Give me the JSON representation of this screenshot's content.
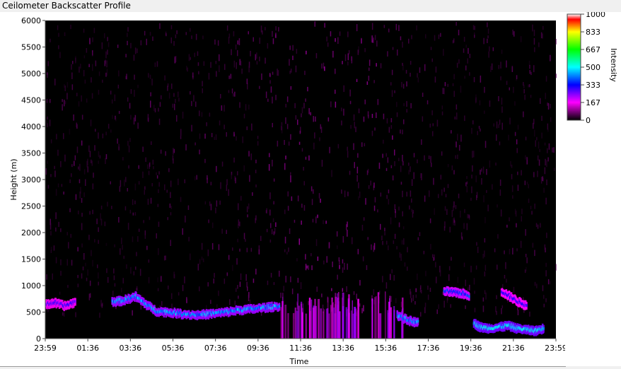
{
  "window": {
    "title": "Ceilometer Backscatter Profile"
  },
  "chart_data": {
    "type": "heatmap",
    "title": "Ceilometer Backscatter Profile",
    "xlabel": "Time",
    "ylabel": "Height (m)",
    "x_ticks": [
      "23:59",
      "01:36",
      "03:36",
      "05:36",
      "07:36",
      "09:36",
      "11:36",
      "13:36",
      "15:36",
      "17:36",
      "19:36",
      "21:36",
      "23:59"
    ],
    "y_ticks": [
      0,
      500,
      1000,
      1500,
      2000,
      2500,
      3000,
      3500,
      4000,
      4500,
      5000,
      5500,
      6000
    ],
    "ylim": [
      0,
      6000
    ],
    "colorbar": {
      "label": "Intensity",
      "ticks": [
        0,
        167,
        333,
        500,
        667,
        833,
        1000
      ],
      "range": [
        0,
        1000
      ],
      "colors": [
        "#000000",
        "#ff00ff",
        "#0000ff",
        "#00ffff",
        "#00ff00",
        "#ffff00",
        "#ff0000",
        "#ffffff"
      ]
    },
    "background_noise": {
      "height_range": [
        1600,
        6000
      ],
      "intensity": 60
    },
    "layers": [
      {
        "name": "",
        "points": [
          [
            0.0,
            650
          ],
          [
            0.4,
            680
          ],
          [
            0.9,
            620
          ],
          [
            1.4,
            700
          ]
        ],
        "intensity": 280
      },
      {
        "name": "",
        "points": [
          [
            3.1,
            700
          ],
          [
            3.6,
            720
          ],
          [
            4.2,
            800
          ],
          [
            4.7,
            650
          ],
          [
            5.2,
            520
          ],
          [
            5.8,
            500
          ],
          [
            6.4,
            470
          ],
          [
            7.1,
            450
          ],
          [
            7.7,
            470
          ],
          [
            8.4,
            500
          ],
          [
            9.0,
            540
          ],
          [
            9.6,
            560
          ],
          [
            10.3,
            590
          ],
          [
            11.0,
            620
          ]
        ],
        "intensity": 420
      },
      {
        "name": "",
        "points": [
          [
            16.5,
            450
          ],
          [
            17.0,
            350
          ],
          [
            17.5,
            300
          ]
        ],
        "intensity": 420
      },
      {
        "name": "",
        "points": [
          [
            18.7,
            900
          ],
          [
            19.1,
            880
          ],
          [
            19.5,
            860
          ],
          [
            19.9,
            820
          ]
        ],
        "intensity": 360
      },
      {
        "name": "",
        "points": [
          [
            20.1,
            300
          ],
          [
            20.4,
            220
          ],
          [
            20.8,
            200
          ],
          [
            21.3,
            220
          ],
          [
            21.7,
            250
          ],
          [
            22.1,
            200
          ],
          [
            22.6,
            170
          ],
          [
            23.0,
            150
          ],
          [
            23.4,
            200
          ]
        ],
        "intensity": 470
      },
      {
        "name": "",
        "points": [
          [
            21.4,
            900
          ],
          [
            21.8,
            800
          ],
          [
            22.2,
            700
          ],
          [
            22.6,
            620
          ]
        ],
        "intensity": 300
      }
    ],
    "vertical_streaks": {
      "time_range": [
        11.0,
        16.8
      ],
      "height_max": 850,
      "intensity": 190
    }
  }
}
